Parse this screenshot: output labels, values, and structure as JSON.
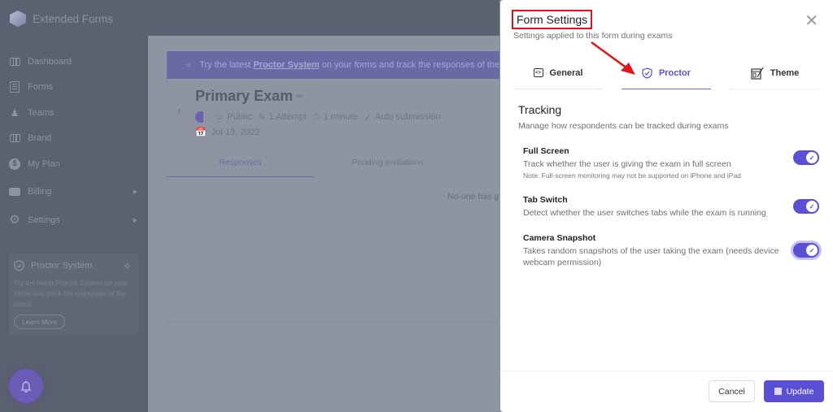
{
  "app": {
    "name": "Extended Forms"
  },
  "sidebar": {
    "items": [
      {
        "label": "Dashboard",
        "icon": "dashboard-icon",
        "has_submenu": false
      },
      {
        "label": "Forms",
        "icon": "forms-icon",
        "has_submenu": false
      },
      {
        "label": "Teams",
        "icon": "teams-icon",
        "has_submenu": false
      },
      {
        "label": "Brand",
        "icon": "brand-icon",
        "has_submenu": false
      },
      {
        "label": "My Plan",
        "icon": "dollar-icon",
        "has_submenu": false
      },
      {
        "label": "Billing",
        "icon": "wallet-icon",
        "has_submenu": true
      },
      {
        "label": "Settings",
        "icon": "gear-icon",
        "has_submenu": true
      }
    ],
    "promo": {
      "title": "Proctor System",
      "text": "Try the latest Proctor System on your forms and track the responses of the users.",
      "button": "Learn More"
    }
  },
  "banner": {
    "prefix": "Try the latest ",
    "link": "Proctor System",
    "suffix": " on your forms and track the responses of the"
  },
  "exam": {
    "title": "Primary Exam",
    "visibility": "Public",
    "attempts": "1 Attempt",
    "duration": "1 minute",
    "submission": "Auto submission",
    "date": "Jul 13, 2022"
  },
  "main_tabs": [
    {
      "label": "Responses",
      "active": true
    },
    {
      "label": "Pending Invitations",
      "active": false
    }
  ],
  "empty_message": "No-one has g",
  "modal": {
    "title": "Form Settings",
    "subtitle": "Settings applied to this form during exams",
    "tabs": [
      {
        "label": "General",
        "active": false
      },
      {
        "label": "Proctor",
        "active": true
      },
      {
        "label": "Theme",
        "active": false
      }
    ],
    "section": {
      "title": "Tracking",
      "subtitle": "Manage how respondents can be tracked during exams"
    },
    "settings": [
      {
        "label": "Full Screen",
        "description": "Track whether the user is giving the exam in full screen",
        "note": "Note: Full-screen monitoring may not be supported on iPhone and iPad",
        "enabled": true
      },
      {
        "label": "Tab Switch",
        "description": "Detect whether the user switches tabs while the exam is running",
        "note": "",
        "enabled": true
      },
      {
        "label": "Camera Snapshot",
        "description": "Takes random snapshots of the user taking the exam (needs device webcam permission)",
        "note": "",
        "enabled": true
      }
    ],
    "cancel_label": "Cancel",
    "update_label": "Update"
  },
  "colors": {
    "accent": "#5b4fd6",
    "highlight_box": "#e0151b",
    "overlay_bg": "#8e94a2"
  }
}
